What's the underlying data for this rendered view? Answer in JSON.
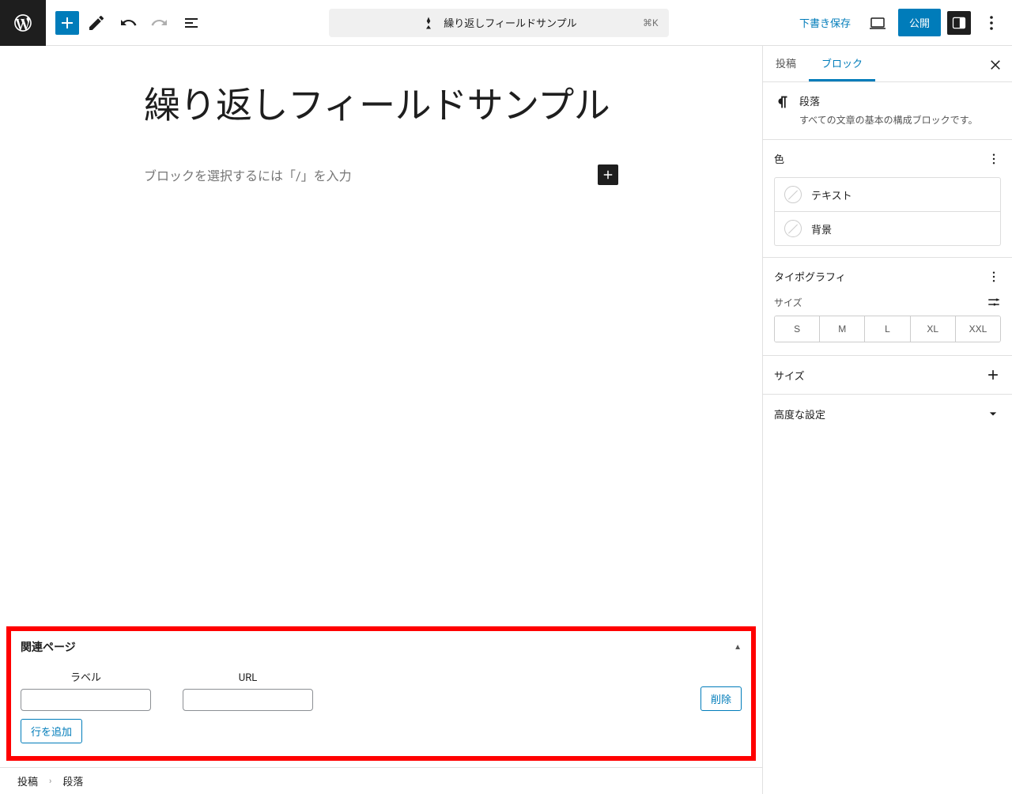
{
  "topbar": {
    "doc_title": "繰り返しフィールドサンプル",
    "shortcut": "⌘K",
    "save_draft": "下書き保存",
    "publish": "公開"
  },
  "canvas": {
    "title": "繰り返しフィールドサンプル",
    "para_placeholder": "ブロックを選択するには「/」を入力"
  },
  "metabox": {
    "title": "関連ページ",
    "col_label": "ラベル",
    "col_url": "URL",
    "delete_btn": "削除",
    "add_row_btn": "行を追加"
  },
  "breadcrumb": {
    "root": "投稿",
    "current": "段落"
  },
  "sidebar": {
    "tab_post": "投稿",
    "tab_block": "ブロック",
    "block_name": "段落",
    "block_desc": "すべての文章の基本の構成ブロックです。",
    "panel_color": "色",
    "color_text": "テキスト",
    "color_bg": "背景",
    "panel_typography": "タイポグラフィ",
    "size_label": "サイズ",
    "sizes": [
      "S",
      "M",
      "L",
      "XL",
      "XXL"
    ],
    "panel_dimensions": "サイズ",
    "panel_advanced": "高度な設定"
  }
}
